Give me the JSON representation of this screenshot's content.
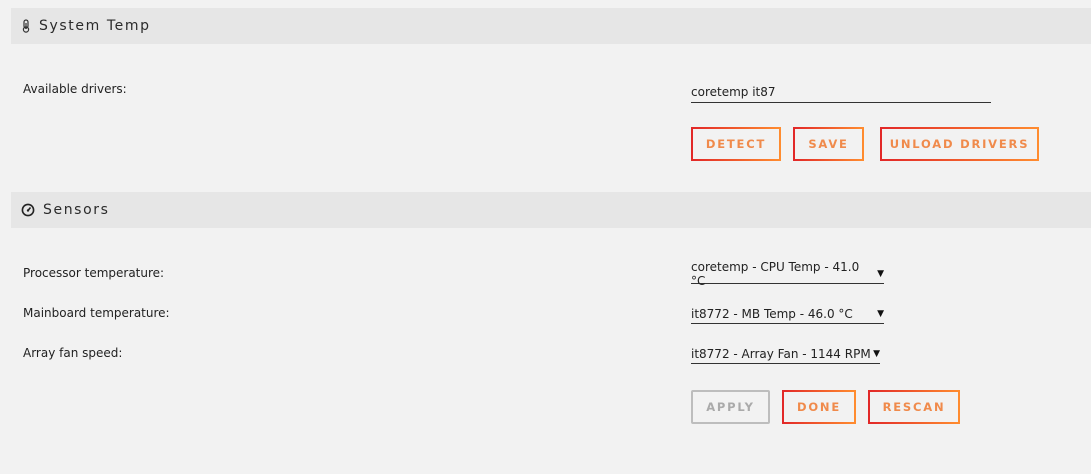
{
  "system_temp": {
    "title": "System Temp",
    "icon": "thermometer-icon",
    "available_drivers_label": "Available drivers:",
    "available_drivers_value": "coretemp it87",
    "buttons": {
      "detect": "DETECT",
      "save": "SAVE",
      "unload": "UNLOAD DRIVERS"
    }
  },
  "sensors": {
    "title": "Sensors",
    "icon": "gauge-icon",
    "processor_label": "Processor temperature:",
    "processor_value": "coretemp - CPU Temp - 41.0 °C",
    "mainboard_label": "Mainboard temperature:",
    "mainboard_value": "it8772 - MB Temp - 46.0 °C",
    "fan_label": "Array fan speed:",
    "fan_value": "it8772 - Array Fan - 1144 RPM",
    "buttons": {
      "apply": "APPLY",
      "done": "DONE",
      "rescan": "RESCAN"
    }
  },
  "colors": {
    "accent_start": "#e22828",
    "accent_end": "#ff8c2f",
    "button_text": "#f08a4b",
    "disabled": "#bdbdbd"
  }
}
